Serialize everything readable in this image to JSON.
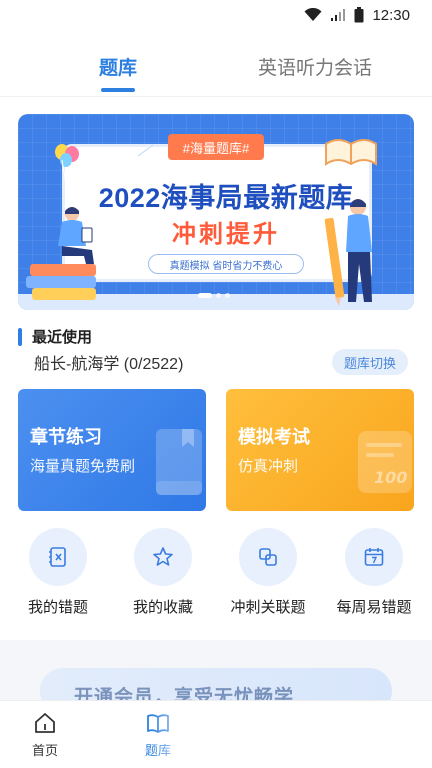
{
  "status_bar": {
    "time": "12:30"
  },
  "tabs": [
    {
      "label": "题库",
      "active": true
    },
    {
      "label": "英语听力会话",
      "active": false
    }
  ],
  "banner": {
    "tag": "#海量题库#",
    "title": "2022海事局最新题库",
    "subtitle": "冲刺提升",
    "chip": "真题模拟  省时省力不费心",
    "slide_count": 3,
    "active_slide": 1
  },
  "recent": {
    "title": "最近使用",
    "course": "船长-航海学",
    "progress": "(0/2522)",
    "switch_label": "题库切换"
  },
  "cards": [
    {
      "title": "章节练习",
      "desc": "海量真题免费刷",
      "color": "#3a84ec"
    },
    {
      "title": "模拟考试",
      "desc": "仿真冲刺",
      "color": "#fbb12e"
    }
  ],
  "quick_actions": [
    {
      "label": "我的错题",
      "icon": "error-book-icon"
    },
    {
      "label": "我的收藏",
      "icon": "star-icon"
    },
    {
      "label": "冲刺关联题",
      "icon": "link-squares-icon"
    },
    {
      "label": "每周易错题",
      "icon": "calendar-icon"
    }
  ],
  "promo": {
    "text": "开通会员，享受无忧畅学"
  },
  "bottom_nav": [
    {
      "label": "首页",
      "icon": "home-icon",
      "active": false
    },
    {
      "label": "题库",
      "icon": "book-icon",
      "active": true
    }
  ],
  "colors": {
    "accent": "#2d7fe0",
    "card_blue": "#3a84ec",
    "card_orange": "#fbb12e"
  }
}
